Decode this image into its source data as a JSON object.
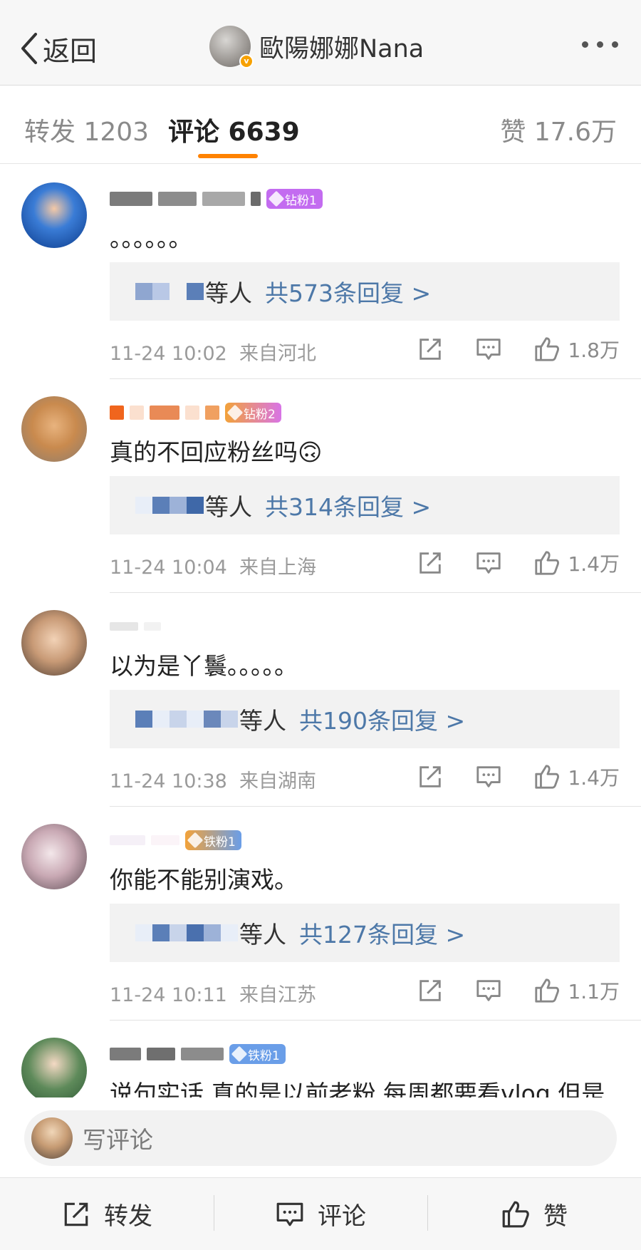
{
  "nav": {
    "back_label": "返回",
    "account_name": "歐陽娜娜Nana",
    "verified_mark": "v"
  },
  "tabs": {
    "repost": "转发 1203",
    "comments": "评论 6639",
    "likes": "赞 17.6万"
  },
  "comments": [
    {
      "badge": "钻粉1",
      "badge_color": "#c36cf0",
      "text": "。。。。。。",
      "reply_who": "等人",
      "reply_link": "共573条回复 >",
      "time": "11-24 10:02",
      "from": "来自河北",
      "likes": "1.8万"
    },
    {
      "badge": "钻粉2",
      "badge_color": "#d874e6",
      "text": "真的不回应粉丝吗🙃",
      "reply_who": "等人",
      "reply_link": "共314条回复 >",
      "time": "11-24 10:04",
      "from": "来自上海",
      "likes": "1.4万"
    },
    {
      "badge": "",
      "badge_color": "",
      "text": "以为是丫鬟。。。。。",
      "reply_who": "等人",
      "reply_link": "共190条回复 >",
      "time": "11-24 10:38",
      "from": "来自湖南",
      "likes": "1.4万"
    },
    {
      "badge": "铁粉1",
      "badge_color": "#6a9ee8",
      "text": "你能不能别演戏。",
      "reply_who": "等人",
      "reply_link": "共127条回复 >",
      "time": "11-24 10:11",
      "from": "来自江苏",
      "likes": "1.1万"
    },
    {
      "badge": "铁粉1",
      "badge_color": "#6a9ee8",
      "text": "说句实话 真的是以前老粉 每周都要看vlog 但是"
    }
  ],
  "write_comment": {
    "placeholder": "写评论"
  },
  "toolbar": {
    "repost": "转发",
    "comment": "评论",
    "like": "赞"
  },
  "colors": {
    "accent": "#ff8200",
    "link": "#4d78a8",
    "muted": "#9a9a9a"
  },
  "icons": [
    "chevron-left-icon",
    "more-dots-icon",
    "share-icon",
    "comment-icon",
    "thumbs-up-icon",
    "diamond-icon",
    "crown-icon"
  ]
}
